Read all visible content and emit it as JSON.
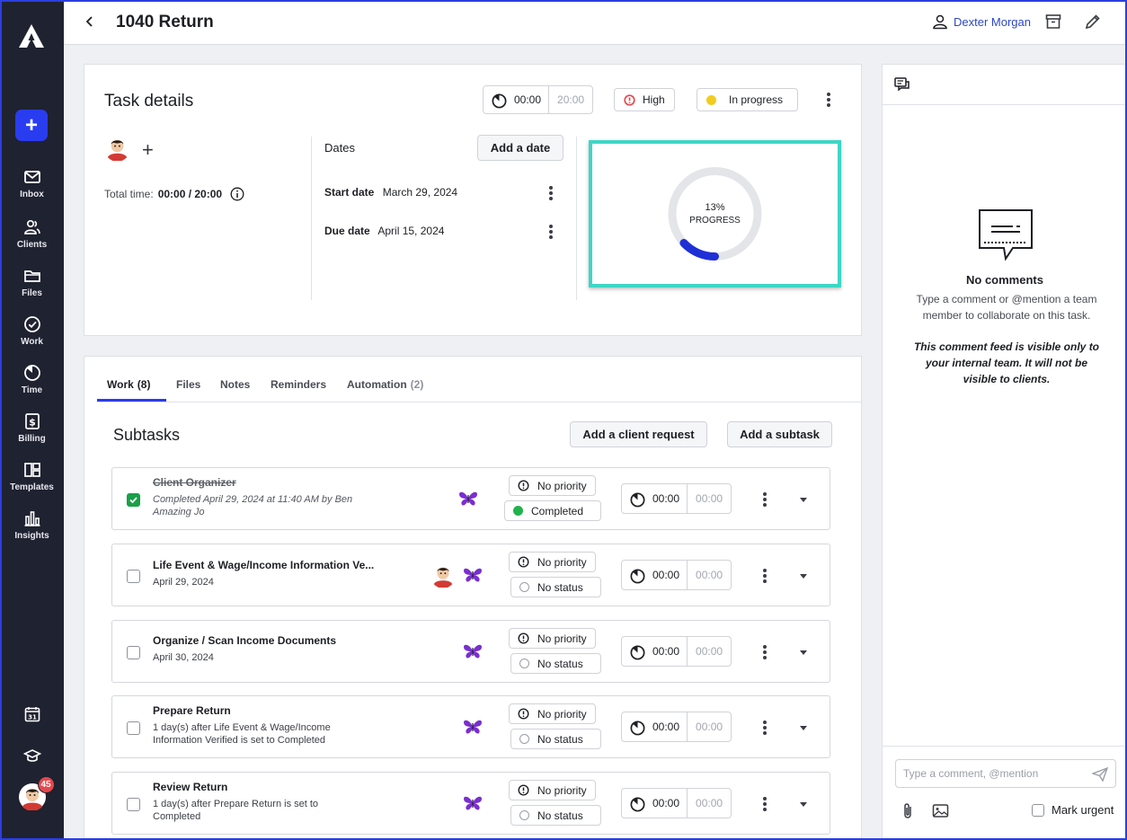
{
  "app": {
    "notification_count": "45"
  },
  "sidebar": {
    "items": [
      {
        "label": "Inbox",
        "icon": "inbox-icon"
      },
      {
        "label": "Clients",
        "icon": "clients-icon"
      },
      {
        "label": "Files",
        "icon": "folder-icon"
      },
      {
        "label": "Work",
        "icon": "check-circle-icon"
      },
      {
        "label": "Time",
        "icon": "clock-icon"
      },
      {
        "label": "Billing",
        "icon": "dollar-icon"
      },
      {
        "label": "Templates",
        "icon": "templates-icon"
      },
      {
        "label": "Insights",
        "icon": "chart-icon"
      }
    ],
    "calendar_day": "31"
  },
  "header": {
    "title": "1040 Return",
    "user_name": "Dexter Morgan"
  },
  "details": {
    "title": "Task details",
    "timer": {
      "elapsed": "00:00",
      "estimate": "20:00"
    },
    "priority": {
      "label": "High",
      "color": "#e5484d"
    },
    "status": {
      "label": "In progress",
      "color": "#f2cc1f"
    },
    "total_time_label": "Total time:",
    "total_time_value": "00:00 / 20:00",
    "dates_label": "Dates",
    "add_date_label": "Add a date",
    "start_date_label": "Start date",
    "start_date": "March 29, 2024",
    "due_date_label": "Due date",
    "due_date": "April 15, 2024",
    "progress": {
      "percent_text": "13%",
      "label": "PROGRESS",
      "value": 0.13,
      "color": "#1f2fd6"
    }
  },
  "work": {
    "tabs": [
      {
        "label": "Work",
        "count": "(8)"
      },
      {
        "label": "Files",
        "count": ""
      },
      {
        "label": "Notes",
        "count": ""
      },
      {
        "label": "Reminders",
        "count": ""
      },
      {
        "label": "Automation",
        "count": "(2)"
      }
    ],
    "subtasks_title": "Subtasks",
    "add_request_label": "Add a client request",
    "add_subtask_label": "Add a subtask",
    "rows": [
      {
        "title": "Client Organizer",
        "sub": "Completed April 29, 2024 at 11:40 AM by Ben Amazing Jo",
        "priority": "No priority",
        "status": "Completed",
        "elapsed": "00:00",
        "estimate": "00:00"
      },
      {
        "title": "Life Event & Wage/Income Information Ve...",
        "sub": "April 29, 2024",
        "priority": "No priority",
        "status": "No status",
        "elapsed": "00:00",
        "estimate": "00:00"
      },
      {
        "title": "Organize / Scan Income Documents",
        "sub": "April 30, 2024",
        "priority": "No priority",
        "status": "No status",
        "elapsed": "00:00",
        "estimate": "00:00"
      },
      {
        "title": "Prepare Return",
        "sub": "1 day(s) after Life Event & Wage/Income Information Verified is set to Completed",
        "priority": "No priority",
        "status": "No status",
        "elapsed": "00:00",
        "estimate": "00:00"
      },
      {
        "title": "Review Return",
        "sub": "1 day(s) after Prepare Return is set to Completed",
        "priority": "No priority",
        "status": "No status",
        "elapsed": "00:00",
        "estimate": "00:00"
      }
    ]
  },
  "comments": {
    "empty_title": "No comments",
    "empty_hint": "Type a comment or @mention a team member to collaborate on this task.",
    "visibility_note": "This comment feed is visible only to your internal team. It will not be visible to clients.",
    "input_placeholder": "Type a comment, @mention",
    "mark_urgent_label": "Mark urgent"
  }
}
